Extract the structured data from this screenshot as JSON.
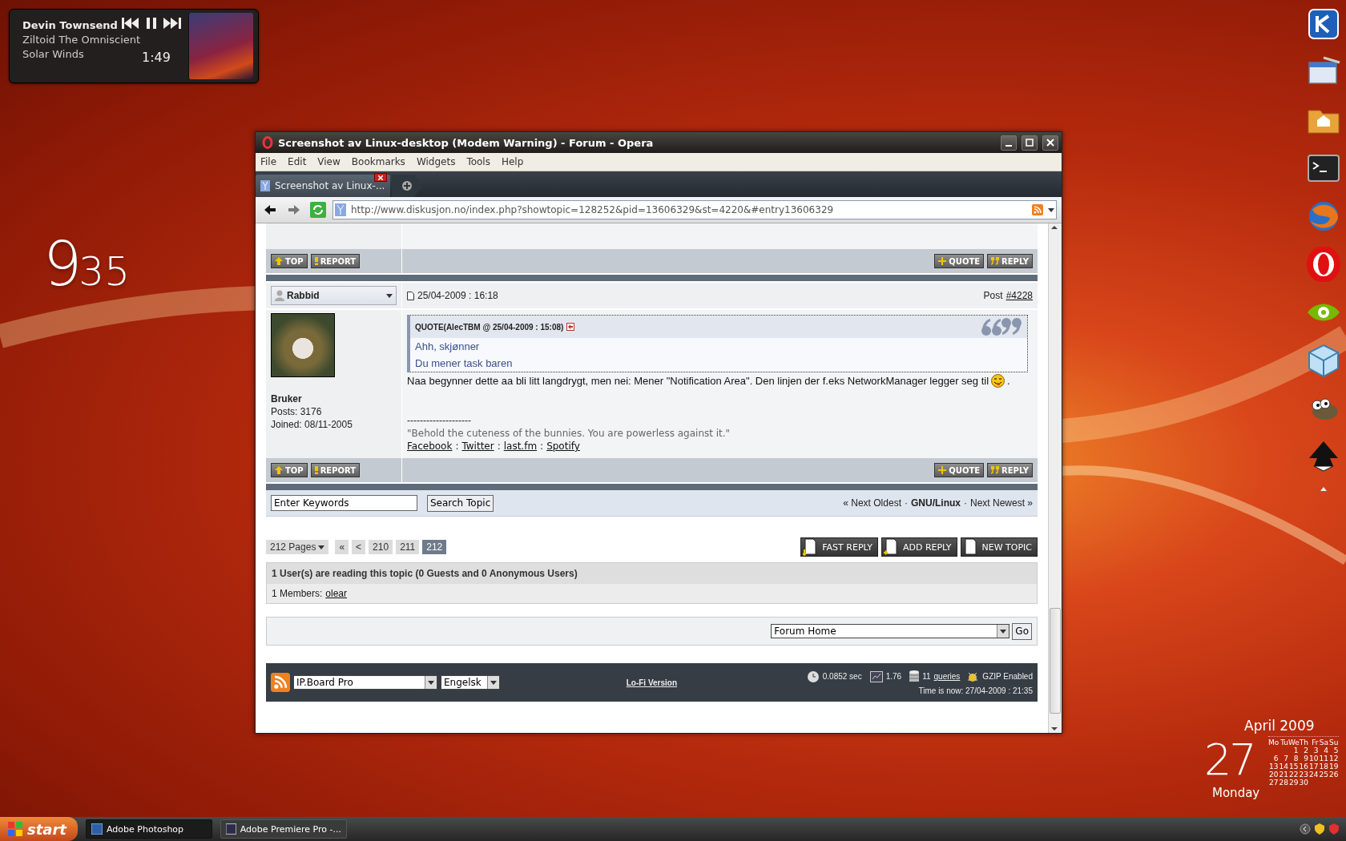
{
  "media_player": {
    "artist": "Devin Townsend",
    "album": "Ziltoid The Omniscient",
    "track": "Solar Winds",
    "time": "1:49"
  },
  "desktop_clock": {
    "hour": "9",
    "minutes": "35"
  },
  "browser": {
    "title": "Screenshot av Linux-desktop (Modem Warning) - Forum - Opera",
    "menu": [
      "File",
      "Edit",
      "View",
      "Bookmarks",
      "Widgets",
      "Tools",
      "Help"
    ],
    "tabs": [
      {
        "label": "Screenshot av Linux-...",
        "selected": true
      }
    ],
    "address": "http://www.diskusjon.no/index.php?showtopic=128252&pid=13606329&st=4220&#entry13606329",
    "page": {
      "action_rows": [
        {
          "left": [
            "TOP",
            "REPORT"
          ],
          "right": [
            "QUOTE",
            "REPLY"
          ]
        },
        {
          "left": [
            "TOP",
            "REPORT"
          ],
          "right": [
            "QUOTE",
            "REPLY"
          ]
        }
      ],
      "post": {
        "author": "Rabbid",
        "date": "25/04-2009 : 16:18",
        "post_label": "Post",
        "post_number": "#4228",
        "group": "Bruker",
        "posts": "Posts: 3176",
        "joined": "Joined: 08/11-2005",
        "quote_header": "QUOTE(AlecTBM @ 25/04-2009 : 15:08)",
        "quote_lines": [
          "Ahh, skjønner",
          "Du mener task baren"
        ],
        "body": "Naa begynner dette aa bli litt langdrygt, men nei: Mener \"Notification Area\". Den linjen der f.eks NetworkManager legger seg til",
        "body_end": ".",
        "signature_rule": "--------------------",
        "signature_quote": "\"Behold the cuteness of the bunnies. You are powerless against it.\"",
        "signature_links": [
          "Facebook",
          "Twitter",
          "last.fm",
          "Spotify"
        ],
        "signature_separators": [
          ":",
          ":",
          ":"
        ]
      },
      "search": {
        "value": "Enter Keywords",
        "button": "Search Topic"
      },
      "topic_nav": {
        "previous": "« Next Oldest",
        "separators": [
          "·",
          "·"
        ],
        "forum": "GNU/Linux",
        "next": "Next Newest »"
      },
      "pages_label": "212 Pages",
      "pagination": [
        {
          "label": "«",
          "selected": false
        },
        {
          "label": "<",
          "selected": false
        },
        {
          "label": "210",
          "selected": false
        },
        {
          "label": "211",
          "selected": false
        },
        {
          "label": "212",
          "selected": true
        }
      ],
      "topic_buttons": [
        "FAST REPLY",
        "ADD REPLY",
        "NEW TOPIC"
      ],
      "active_users": {
        "title": "1 User(s) are reading this topic (0 Guests and 0 Anonymous Users)",
        "members_label": "1 Members:",
        "members": [
          "olear"
        ]
      },
      "jump": {
        "selected": "Forum Home",
        "button": "Go"
      },
      "footer": {
        "skin": "IP.Board Pro",
        "language": "Engelsk",
        "lofi": "Lo-Fi Version",
        "exec_time": "0.0852 sec",
        "load": "1.76",
        "queries_count": "11",
        "queries_link": "queries",
        "gzip": "GZIP Enabled",
        "time_now": "Time is now: 27/04-2009 : 21:35"
      }
    }
  },
  "calendar": {
    "month": "April 2009",
    "day": "27",
    "weekday": "Monday",
    "weekdays": [
      "Mo",
      "Tu",
      "We",
      "Th",
      "Fr",
      "Sa",
      "Su"
    ],
    "weeks": [
      [
        "1",
        "2",
        "3",
        "4",
        "5"
      ],
      [
        "6",
        "7",
        "8",
        "9",
        "10",
        "11",
        "12"
      ],
      [
        "13",
        "14",
        "15",
        "16",
        "17",
        "18",
        "19"
      ],
      [
        "20",
        "21",
        "22",
        "23",
        "24",
        "25",
        "26"
      ],
      [
        "27",
        "28",
        "29",
        "30"
      ]
    ]
  },
  "taskbar": {
    "start": "start",
    "items": [
      {
        "label": "Adobe Photoshop",
        "selected": true
      },
      {
        "label": "Adobe Premiere Pro -...",
        "selected": false
      }
    ]
  }
}
